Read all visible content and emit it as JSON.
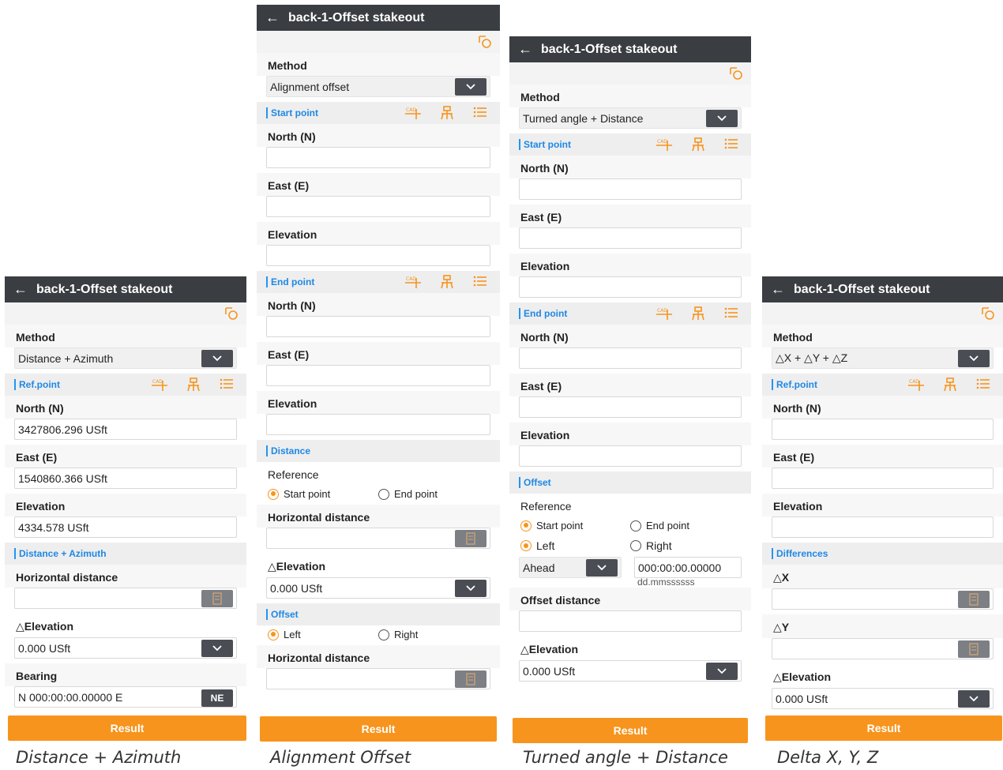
{
  "app": {
    "title": "back-1-Offset stakeout",
    "back_glyph": "←",
    "result_label": "Result",
    "dropdown_glyph": "⌄"
  },
  "colors": {
    "topbar": "#3a3d41",
    "accent": "#f7941d",
    "section_text": "#1e88e5"
  },
  "panel1": {
    "method_label": "Method",
    "method_value": "Distance + Azimuth",
    "section_ref": "Ref.point",
    "north_label": "North (N)",
    "north_value": "3427806.296 USft",
    "east_label": "East (E)",
    "east_value": "1540860.366 USft",
    "elev_label": "Elevation",
    "elev_value": "4334.578 USft",
    "section_dist": "Distance + Azimuth",
    "hdist_label": "Horizontal distance",
    "delev_label": "△Elevation",
    "delev_value": "0.000 USft",
    "bearing_label": "Bearing",
    "bearing_value": "N 000:00:00.00000 E",
    "bearing_btn": "NE",
    "caption": "Distance + Azimuth"
  },
  "panel2": {
    "method_label": "Method",
    "method_value": "Alignment offset",
    "section_start": "Start point",
    "north_label": "North (N)",
    "east_label": "East (E)",
    "elev_label": "Elevation",
    "section_end": "End point",
    "north2_label": "North (N)",
    "east2_label": "East (E)",
    "elev2_label": "Elevation",
    "section_distance": "Distance",
    "reference_label": "Reference",
    "radio_start": "Start point",
    "radio_end": "End point",
    "hdist_label": "Horizontal distance",
    "delev_label": "△Elevation",
    "delev_value": "0.000 USft",
    "section_offset": "Offset",
    "radio_left": "Left",
    "radio_right": "Right",
    "hdist2_label": "Horizontal distance",
    "caption": "Alignment Offset"
  },
  "panel3": {
    "method_label": "Method",
    "method_value": "Turned angle + Distance",
    "section_start": "Start point",
    "north_label": "North (N)",
    "east_label": "East (E)",
    "elev_label": "Elevation",
    "section_end": "End point",
    "north2_label": "North (N)",
    "east2_label": "East (E)",
    "elev2_label": "Elevation",
    "section_offset": "Offset",
    "reference_label": "Reference",
    "radio_start": "Start point",
    "radio_end": "End point",
    "radio_left": "Left",
    "radio_right": "Right",
    "ahead_value": "Ahead",
    "angle_value": "000:00:00.00000",
    "angle_format": "dd.mmssssss",
    "offset_label": "Offset distance",
    "delev_label": "△Elevation",
    "delev_value": "0.000 USft",
    "caption": "Turned angle + Distance"
  },
  "panel4": {
    "method_label": "Method",
    "method_value": "△X + △Y + △Z",
    "section_ref": "Ref.point",
    "north_label": "North (N)",
    "east_label": "East (E)",
    "elev_label": "Elevation",
    "section_diff": "Differences",
    "dx_label": "△X",
    "dy_label": "△Y",
    "delev_label": "△Elevation",
    "delev_value": "0.000 USft",
    "caption": "Delta X, Y, Z"
  }
}
